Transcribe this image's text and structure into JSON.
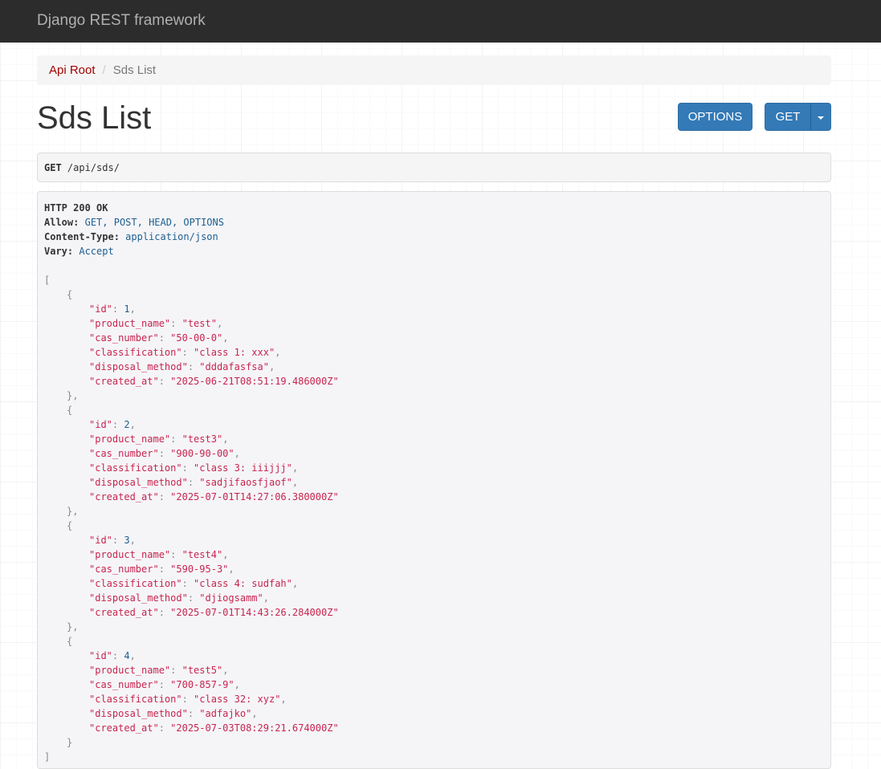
{
  "navbar": {
    "brand": "Django REST framework"
  },
  "breadcrumb": {
    "root": "Api Root",
    "separator": "/",
    "current": "Sds List"
  },
  "page": {
    "title": "Sds List",
    "options_label": "OPTIONS",
    "get_label": "GET"
  },
  "request": {
    "method": "GET",
    "path": "/api/sds/"
  },
  "response": {
    "status": "HTTP 200 OK",
    "headers": [
      {
        "key": "Allow:",
        "value": "GET, POST, HEAD, OPTIONS"
      },
      {
        "key": "Content-Type:",
        "value": "application/json"
      },
      {
        "key": "Vary:",
        "value": "Accept"
      }
    ],
    "records": [
      {
        "id": "1",
        "product_name": "\"test\"",
        "cas_number": "\"50-00-0\"",
        "classification": "\"class 1: xxx\"",
        "disposal_method": "\"dddafasfsa\"",
        "created_at": "\"2025-06-21T08:51:19.486000Z\""
      },
      {
        "id": "2",
        "product_name": "\"test3\"",
        "cas_number": "\"900-90-00\"",
        "classification": "\"class 3: iiijjj\"",
        "disposal_method": "\"sadjifaosfjaof\"",
        "created_at": "\"2025-07-01T14:27:06.380000Z\""
      },
      {
        "id": "3",
        "product_name": "\"test4\"",
        "cas_number": "\"590-95-3\"",
        "classification": "\"class 4: sudfah\"",
        "disposal_method": "\"djiogsamm\"",
        "created_at": "\"2025-07-01T14:43:26.284000Z\""
      },
      {
        "id": "4",
        "product_name": "\"test5\"",
        "cas_number": "\"700-857-9\"",
        "classification": "\"class 32: xyz\"",
        "disposal_method": "\"adfajko\"",
        "created_at": "\"2025-07-03T08:29:21.674000Z\""
      }
    ]
  },
  "colors": {
    "navbar": "#2c2c2c",
    "accent": "#337ab7",
    "breadcrumb_link": "#a30000",
    "json_string": "#c7254e",
    "json_number": "#1e5f8f"
  }
}
